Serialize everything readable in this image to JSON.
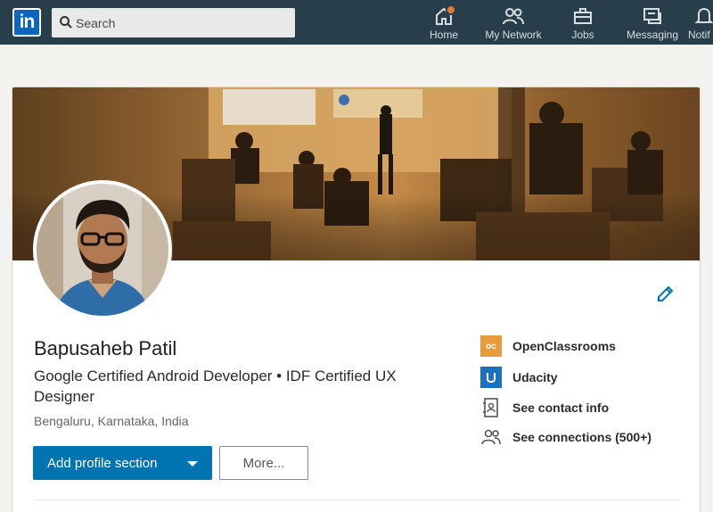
{
  "nav": {
    "logo_text": "in",
    "search_placeholder": "Search",
    "items": [
      {
        "label": "Home",
        "icon": "home-icon"
      },
      {
        "label": "My Network",
        "icon": "network-icon"
      },
      {
        "label": "Jobs",
        "icon": "jobs-icon"
      },
      {
        "label": "Messaging",
        "icon": "messaging-icon"
      },
      {
        "label": "Notif",
        "icon": "notifications-icon"
      }
    ]
  },
  "profile": {
    "name": "Bapusaheb Patil",
    "headline": "Google Certified Android Developer • IDF Certified UX Designer",
    "location": "Bengaluru, Karnataka, India",
    "add_section_label": "Add profile section",
    "more_label": "More..."
  },
  "sidebar": {
    "school_1": "OpenClassrooms",
    "school_2": "Udacity",
    "contact": "See contact info",
    "connections": "See connections (500+)"
  },
  "colors": {
    "nav_bg": "#283e4a",
    "primary_button": "#0073b1",
    "brand_blue": "#0a66c2",
    "notification_dot": "#dd7e35"
  }
}
